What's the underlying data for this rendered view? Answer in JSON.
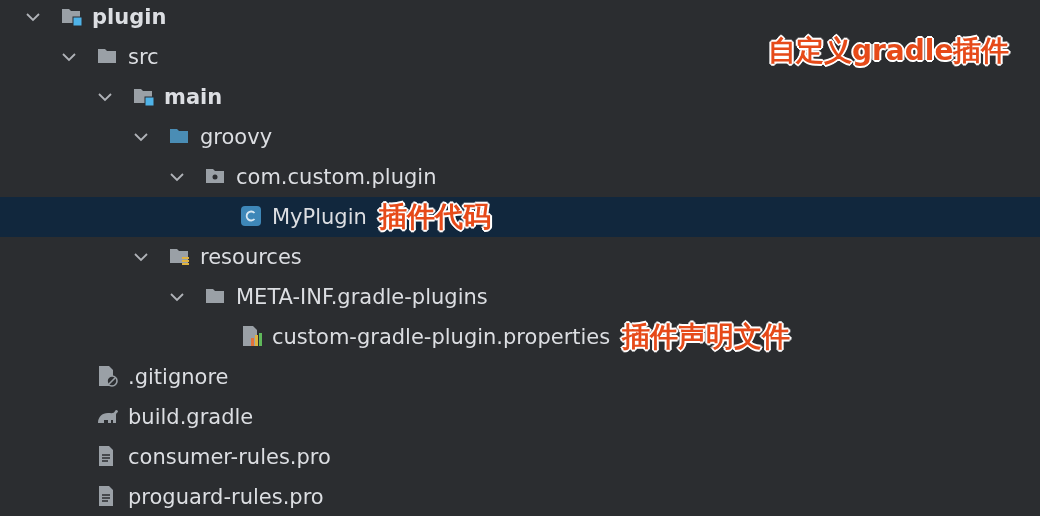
{
  "tree": [
    {
      "label": "plugin",
      "kind": "module",
      "expanded": true,
      "selected": false,
      "children": [
        {
          "label": "src",
          "kind": "folder",
          "expanded": true,
          "selected": false,
          "children": [
            {
              "label": "main",
              "kind": "module",
              "expanded": true,
              "selected": false,
              "children": [
                {
                  "label": "groovy",
                  "kind": "source",
                  "expanded": true,
                  "selected": false,
                  "children": [
                    {
                      "label": "com.custom.plugin",
                      "kind": "package",
                      "expanded": true,
                      "selected": false,
                      "children": [
                        {
                          "label": "MyPlugin",
                          "kind": "class",
                          "selected": true,
                          "note": "插件代码"
                        }
                      ]
                    }
                  ]
                },
                {
                  "label": "resources",
                  "kind": "resources",
                  "expanded": true,
                  "selected": false,
                  "children": [
                    {
                      "label": "META-INF.gradle-plugins",
                      "kind": "folder",
                      "expanded": true,
                      "selected": false,
                      "children": [
                        {
                          "label": "custom-gradle-plugin.properties",
                          "kind": "properties",
                          "selected": false,
                          "note": "插件声明文件"
                        }
                      ]
                    }
                  ]
                }
              ]
            }
          ]
        },
        {
          "label": ".gitignore",
          "kind": "ignore",
          "selected": false
        },
        {
          "label": "build.gradle",
          "kind": "gradle",
          "selected": false
        },
        {
          "label": "consumer-rules.pro",
          "kind": "text",
          "selected": false
        },
        {
          "label": "proguard-rules.pro",
          "kind": "text",
          "selected": false
        }
      ]
    }
  ],
  "overlay_note": "自定义gradle插件"
}
